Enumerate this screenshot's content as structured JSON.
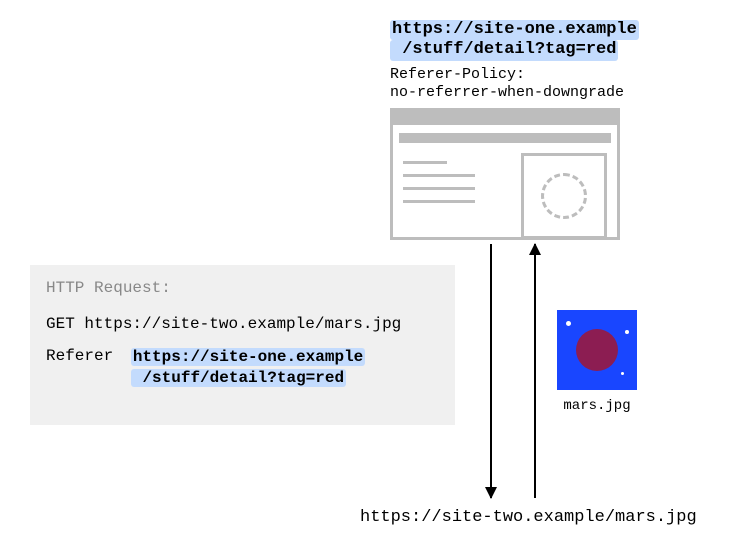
{
  "top_url_line1": "https://site-one.example",
  "top_url_line2": "/stuff/detail?tag=red",
  "referrer_policy_label": "Referer-Policy:",
  "referrer_policy_value": "no-referrer-when-downgrade",
  "http_request": {
    "label": "HTTP Request:",
    "method": "GET",
    "request_url": "https://site-two.example/mars.jpg",
    "referer_label": "Referer",
    "referer_url_line1": "https://site-one.example",
    "referer_url_line2": "/stuff/detail?tag=red"
  },
  "mars_caption": "mars.jpg",
  "bottom_url": "https://site-two.example/mars.jpg"
}
